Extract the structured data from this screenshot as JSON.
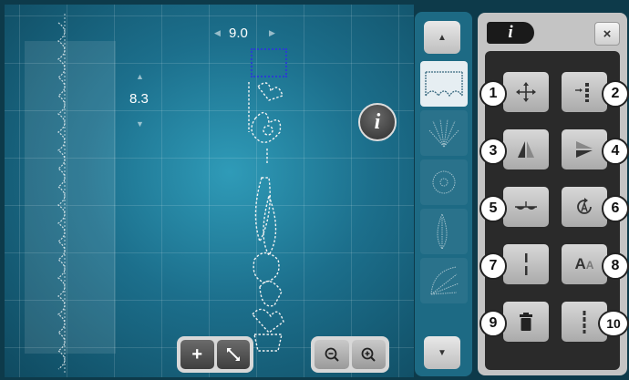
{
  "canvas": {
    "width_value": "9.0",
    "height_value": "8.3"
  },
  "info_button": {
    "label": "i"
  },
  "bottom_controls": {
    "add_label": "+",
    "zoom_out_icon": "zoom-out-icon",
    "zoom_in_icon": "zoom-in-icon",
    "expand_icon": "expand-arrows-icon"
  },
  "thumbnails": [
    {
      "name": "stitch-pattern-scallop",
      "selected": true
    },
    {
      "name": "stitch-pattern-burst",
      "selected": false
    },
    {
      "name": "stitch-pattern-flower",
      "selected": false
    },
    {
      "name": "stitch-pattern-leaf",
      "selected": false
    },
    {
      "name": "stitch-pattern-fan",
      "selected": false
    }
  ],
  "panel": {
    "title": "i",
    "close_label": "×"
  },
  "functions": [
    {
      "number": "1",
      "icon": "move-arrows-icon"
    },
    {
      "number": "2",
      "icon": "needle-position-icon"
    },
    {
      "number": "3",
      "icon": "mirror-left-right-icon"
    },
    {
      "number": "4",
      "icon": "mirror-up-down-icon"
    },
    {
      "number": "5",
      "icon": "balance-icon"
    },
    {
      "number": "6",
      "icon": "pattern-repeat-icon"
    },
    {
      "number": "7",
      "icon": "stitch-length-icon"
    },
    {
      "number": "8",
      "icon": "text-size-icon",
      "label": "A"
    },
    {
      "number": "9",
      "icon": "delete-icon"
    },
    {
      "number": "10",
      "icon": "stitch-density-icon"
    }
  ],
  "colors": {
    "canvas": "#1c6f8c",
    "panel": "#c4c4c4",
    "selection": "#2a3fd0"
  }
}
